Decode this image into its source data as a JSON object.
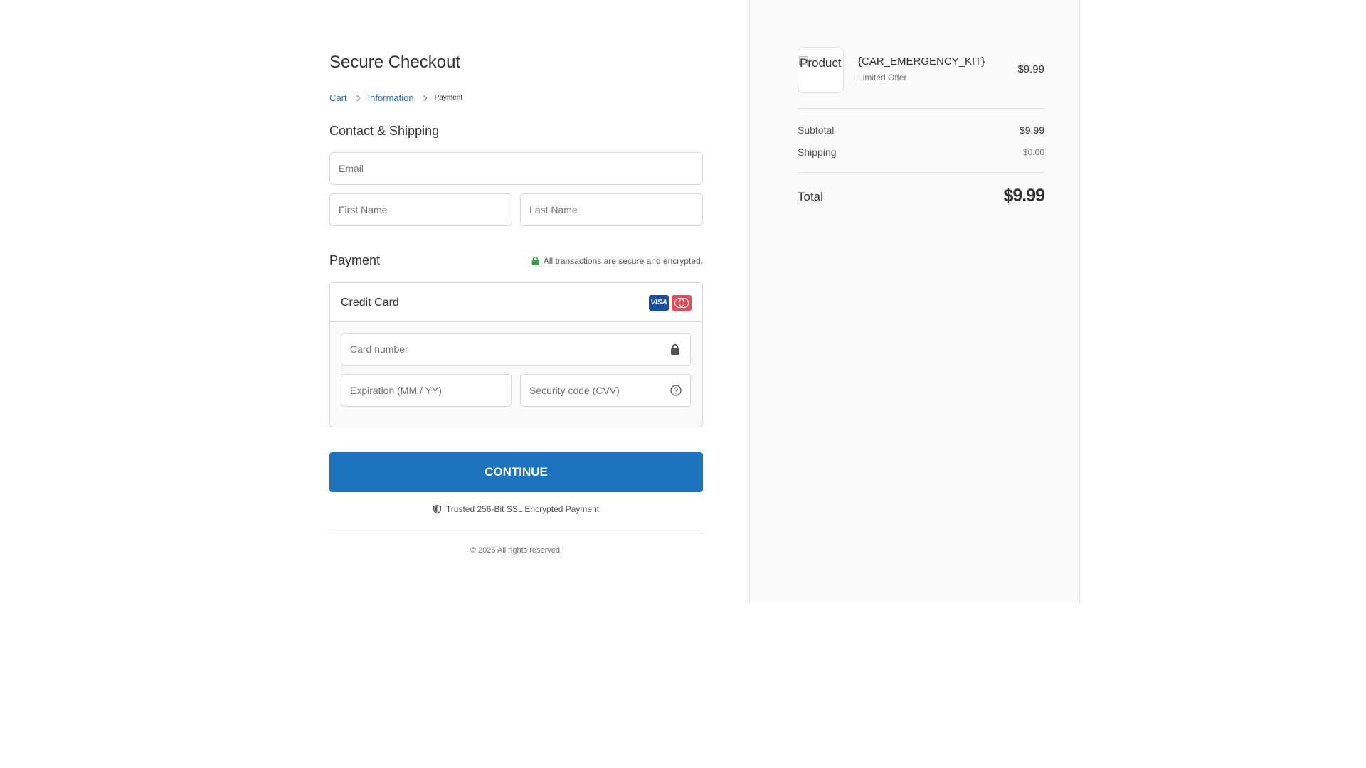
{
  "checkout": {
    "title": "Secure Checkout",
    "breadcrumb": {
      "items": [
        "Cart",
        "Information"
      ],
      "current": "Payment"
    },
    "contact": {
      "title": "Contact & Shipping",
      "email_placeholder": "Email",
      "first_name_placeholder": "First Name",
      "last_name_placeholder": "Last Name"
    },
    "payment": {
      "title": "Payment",
      "secure_note": "All transactions are secure and encrypted.",
      "method_label": "Credit Card",
      "brand_visa": "VISA",
      "card_number_placeholder": "Card number",
      "expiration_placeholder": "Expiration (MM / YY)",
      "cvv_placeholder": "Security code (CVV)"
    },
    "continue_label": "CONTINUE",
    "ssl_note": "Trusted 256-Bit SSL Encrypted Payment",
    "footer": "© 2026 All rights reserved."
  },
  "summary": {
    "product": {
      "image_alt": "Product",
      "name": "{CAR_EMERGENCY_KIT}",
      "subtitle": "Limited Offer",
      "price": "$9.99"
    },
    "subtotal_label": "Subtotal",
    "subtotal_value": "$9.99",
    "shipping_label": "Shipping",
    "shipping_value": "$0.00",
    "total_label": "Total",
    "total_value": "$9.99"
  },
  "colors": {
    "accent": "#1e73be",
    "secure_green": "#2ea44f",
    "panel_bg": "#fafafa"
  }
}
